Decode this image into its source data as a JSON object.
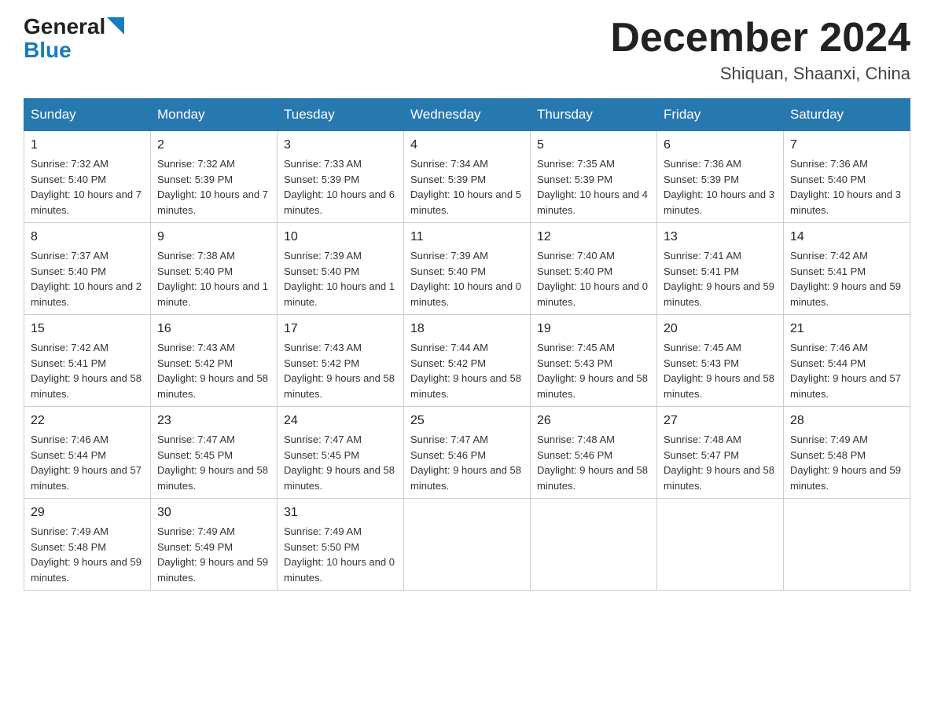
{
  "header": {
    "logo_general": "General",
    "logo_blue": "Blue",
    "month_title": "December 2024",
    "subtitle": "Shiquan, Shaanxi, China"
  },
  "days_of_week": [
    "Sunday",
    "Monday",
    "Tuesday",
    "Wednesday",
    "Thursday",
    "Friday",
    "Saturday"
  ],
  "weeks": [
    [
      {
        "day": "1",
        "sunrise": "7:32 AM",
        "sunset": "5:40 PM",
        "daylight": "10 hours and 7 minutes."
      },
      {
        "day": "2",
        "sunrise": "7:32 AM",
        "sunset": "5:39 PM",
        "daylight": "10 hours and 7 minutes."
      },
      {
        "day": "3",
        "sunrise": "7:33 AM",
        "sunset": "5:39 PM",
        "daylight": "10 hours and 6 minutes."
      },
      {
        "day": "4",
        "sunrise": "7:34 AM",
        "sunset": "5:39 PM",
        "daylight": "10 hours and 5 minutes."
      },
      {
        "day": "5",
        "sunrise": "7:35 AM",
        "sunset": "5:39 PM",
        "daylight": "10 hours and 4 minutes."
      },
      {
        "day": "6",
        "sunrise": "7:36 AM",
        "sunset": "5:39 PM",
        "daylight": "10 hours and 3 minutes."
      },
      {
        "day": "7",
        "sunrise": "7:36 AM",
        "sunset": "5:40 PM",
        "daylight": "10 hours and 3 minutes."
      }
    ],
    [
      {
        "day": "8",
        "sunrise": "7:37 AM",
        "sunset": "5:40 PM",
        "daylight": "10 hours and 2 minutes."
      },
      {
        "day": "9",
        "sunrise": "7:38 AM",
        "sunset": "5:40 PM",
        "daylight": "10 hours and 1 minute."
      },
      {
        "day": "10",
        "sunrise": "7:39 AM",
        "sunset": "5:40 PM",
        "daylight": "10 hours and 1 minute."
      },
      {
        "day": "11",
        "sunrise": "7:39 AM",
        "sunset": "5:40 PM",
        "daylight": "10 hours and 0 minutes."
      },
      {
        "day": "12",
        "sunrise": "7:40 AM",
        "sunset": "5:40 PM",
        "daylight": "10 hours and 0 minutes."
      },
      {
        "day": "13",
        "sunrise": "7:41 AM",
        "sunset": "5:41 PM",
        "daylight": "9 hours and 59 minutes."
      },
      {
        "day": "14",
        "sunrise": "7:42 AM",
        "sunset": "5:41 PM",
        "daylight": "9 hours and 59 minutes."
      }
    ],
    [
      {
        "day": "15",
        "sunrise": "7:42 AM",
        "sunset": "5:41 PM",
        "daylight": "9 hours and 58 minutes."
      },
      {
        "day": "16",
        "sunrise": "7:43 AM",
        "sunset": "5:42 PM",
        "daylight": "9 hours and 58 minutes."
      },
      {
        "day": "17",
        "sunrise": "7:43 AM",
        "sunset": "5:42 PM",
        "daylight": "9 hours and 58 minutes."
      },
      {
        "day": "18",
        "sunrise": "7:44 AM",
        "sunset": "5:42 PM",
        "daylight": "9 hours and 58 minutes."
      },
      {
        "day": "19",
        "sunrise": "7:45 AM",
        "sunset": "5:43 PM",
        "daylight": "9 hours and 58 minutes."
      },
      {
        "day": "20",
        "sunrise": "7:45 AM",
        "sunset": "5:43 PM",
        "daylight": "9 hours and 58 minutes."
      },
      {
        "day": "21",
        "sunrise": "7:46 AM",
        "sunset": "5:44 PM",
        "daylight": "9 hours and 57 minutes."
      }
    ],
    [
      {
        "day": "22",
        "sunrise": "7:46 AM",
        "sunset": "5:44 PM",
        "daylight": "9 hours and 57 minutes."
      },
      {
        "day": "23",
        "sunrise": "7:47 AM",
        "sunset": "5:45 PM",
        "daylight": "9 hours and 58 minutes."
      },
      {
        "day": "24",
        "sunrise": "7:47 AM",
        "sunset": "5:45 PM",
        "daylight": "9 hours and 58 minutes."
      },
      {
        "day": "25",
        "sunrise": "7:47 AM",
        "sunset": "5:46 PM",
        "daylight": "9 hours and 58 minutes."
      },
      {
        "day": "26",
        "sunrise": "7:48 AM",
        "sunset": "5:46 PM",
        "daylight": "9 hours and 58 minutes."
      },
      {
        "day": "27",
        "sunrise": "7:48 AM",
        "sunset": "5:47 PM",
        "daylight": "9 hours and 58 minutes."
      },
      {
        "day": "28",
        "sunrise": "7:49 AM",
        "sunset": "5:48 PM",
        "daylight": "9 hours and 59 minutes."
      }
    ],
    [
      {
        "day": "29",
        "sunrise": "7:49 AM",
        "sunset": "5:48 PM",
        "daylight": "9 hours and 59 minutes."
      },
      {
        "day": "30",
        "sunrise": "7:49 AM",
        "sunset": "5:49 PM",
        "daylight": "9 hours and 59 minutes."
      },
      {
        "day": "31",
        "sunrise": "7:49 AM",
        "sunset": "5:50 PM",
        "daylight": "10 hours and 0 minutes."
      },
      null,
      null,
      null,
      null
    ]
  ]
}
